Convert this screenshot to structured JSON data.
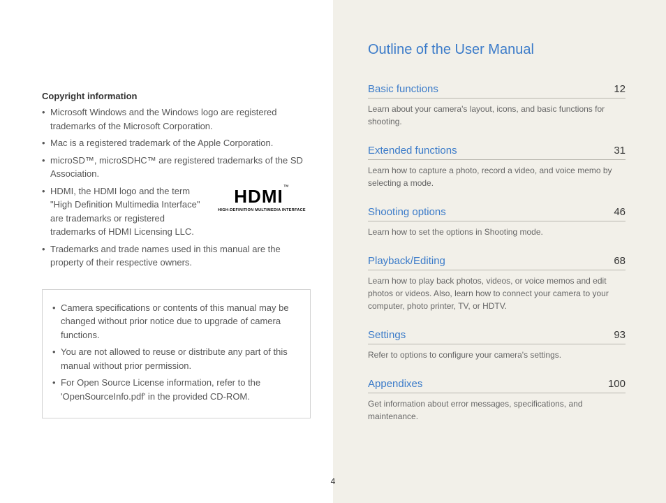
{
  "left": {
    "copyright_heading": "Copyright information",
    "bullets": [
      "Microsoft Windows and the Windows logo are registered trademarks of the Microsoft Corporation.",
      "Mac is a registered trademark of the Apple Corporation.",
      "microSD™, microSDHC™ are registered trademarks of the SD Association.",
      "HDMI, the HDMI logo and the term \"High Definition Multimedia Interface\" are trademarks or registered trademarks of HDMI Licensing LLC.",
      "Trademarks and trade names used in this manual are the property of their respective owners."
    ],
    "hdmi_logo_main": "HDMI",
    "hdmi_logo_tm": "™",
    "hdmi_logo_sub": "HIGH-DEFINITION MULTIMEDIA INTERFACE",
    "notes": [
      "Camera specifications or contents of this manual may be changed without prior notice due to upgrade of camera functions.",
      "You are not allowed to reuse or distribute any part of this manual without prior permission.",
      "For Open Source License information, refer to the 'OpenSourceInfo.pdf' in the provided CD-ROM."
    ]
  },
  "right": {
    "title": "Outline of the User Manual",
    "sections": [
      {
        "name": "Basic functions",
        "page": "12",
        "desc": "Learn about your camera's layout, icons, and basic functions for shooting."
      },
      {
        "name": "Extended functions",
        "page": "31",
        "desc": "Learn how to capture a photo, record a video, and voice memo by selecting a mode."
      },
      {
        "name": "Shooting options",
        "page": "46",
        "desc": "Learn how to set the options in Shooting mode."
      },
      {
        "name": "Playback/Editing",
        "page": "68",
        "desc": "Learn how to play back photos, videos, or voice memos and edit photos or videos. Also, learn how to connect your camera to your computer, photo printer, TV, or HDTV."
      },
      {
        "name": "Settings",
        "page": "93",
        "desc": "Refer to options to configure your camera's settings."
      },
      {
        "name": "Appendixes",
        "page": "100",
        "desc": "Get information about error messages, specifications, and maintenance."
      }
    ]
  },
  "page_number": "4"
}
